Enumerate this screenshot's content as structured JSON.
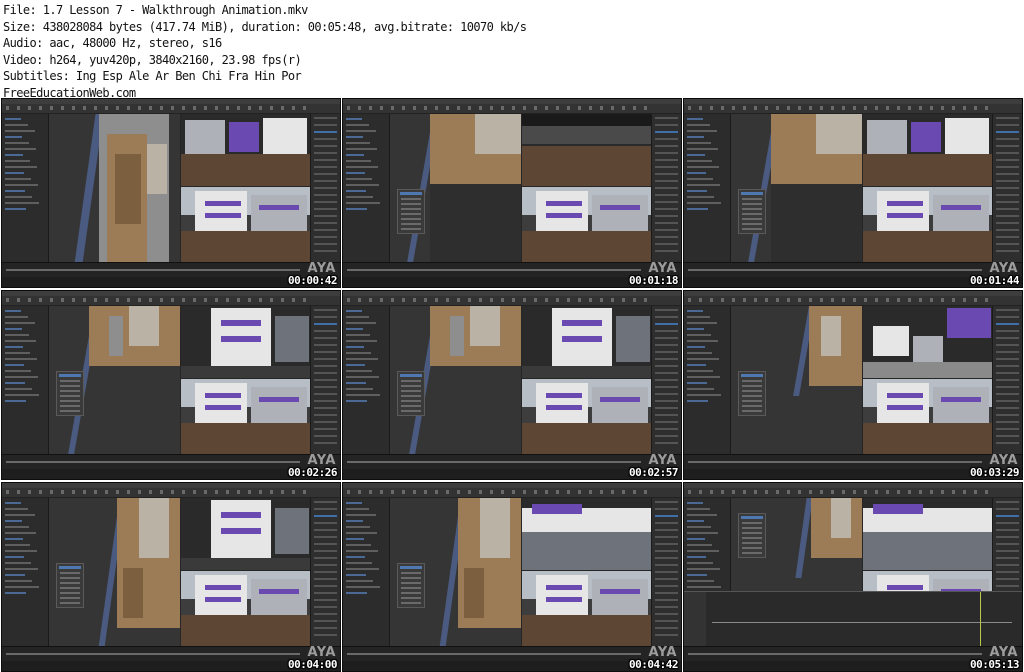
{
  "header": {
    "file": "File: 1.7 Lesson 7 - Walkthrough Animation.mkv",
    "size": "Size: 438028084 bytes (417.74 MiB), duration: 00:05:48, avg.bitrate: 10070 kb/s",
    "audio": "Audio: aac, 48000 Hz, stereo, s16",
    "video": "Video: h264, yuv420p, 3840x2160, 23.98 fps(r)",
    "subtitles": "Subtitles: Ing Esp Ale Ar Ben Chi Fra Hin Por",
    "site": "FreeEducationWeb.com"
  },
  "thumbnails": [
    {
      "timestamp": "00:00:42",
      "watermark": "AYA"
    },
    {
      "timestamp": "00:01:18",
      "watermark": "AYA"
    },
    {
      "timestamp": "00:01:44",
      "watermark": "AYA"
    },
    {
      "timestamp": "00:02:26",
      "watermark": "AYA"
    },
    {
      "timestamp": "00:02:57",
      "watermark": "AYA"
    },
    {
      "timestamp": "00:03:29",
      "watermark": "AYA"
    },
    {
      "timestamp": "00:04:00",
      "watermark": "AYA"
    },
    {
      "timestamp": "00:04:42",
      "watermark": "AYA"
    },
    {
      "timestamp": "00:05:13",
      "watermark": "AYA"
    }
  ],
  "colors": {
    "background": "#ffffff",
    "app_dark": "#262626",
    "timeline_red": "#c0302b",
    "selection_blue": "#4f78b0",
    "plan_brown": "#9c7c56",
    "facade_purple": "#6a4ab0"
  }
}
